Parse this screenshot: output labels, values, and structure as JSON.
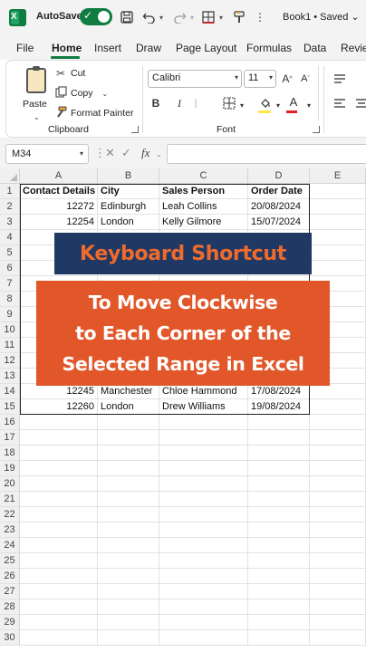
{
  "titlebar": {
    "autosave_label": "AutoSave",
    "autosave_on": true,
    "workbook_title": "Book1 • Saved ⌄"
  },
  "tabs": [
    "File",
    "Home",
    "Insert",
    "Draw",
    "Page Layout",
    "Formulas",
    "Data",
    "Review"
  ],
  "active_tab": "Home",
  "ribbon": {
    "clipboard": {
      "paste_label": "Paste",
      "cut_label": "Cut",
      "copy_label": "Copy",
      "format_painter_label": "Format Painter",
      "group_label": "Clipboard"
    },
    "font": {
      "font_name": "Calibri",
      "font_size": "11",
      "group_label": "Font"
    }
  },
  "formula_bar": {
    "name_box": "M34",
    "fx_label": "fx",
    "formula": ""
  },
  "grid": {
    "columns": [
      "A",
      "B",
      "C",
      "D",
      "E"
    ],
    "rows": [
      "1",
      "2",
      "3",
      "4",
      "5",
      "6",
      "7",
      "8",
      "9",
      "10",
      "11",
      "12",
      "13",
      "14",
      "15",
      "16",
      "17",
      "18",
      "19",
      "20",
      "21",
      "22",
      "23",
      "24",
      "25",
      "26",
      "27",
      "28",
      "29",
      "30"
    ],
    "header_row": [
      "Contact Details",
      "City",
      "Sales Person",
      "Order Date"
    ],
    "visible_rows": [
      {
        "row": 2,
        "id": "12272",
        "city": "Edinburgh",
        "person": "Leah Collins",
        "date": "20/08/2024"
      },
      {
        "row": 3,
        "id": "12254",
        "city": "London",
        "person": "Kelly Gilmore",
        "date": "15/07/2024"
      },
      {
        "row": 14,
        "id": "12245",
        "city": "Manchester",
        "person": "Chloe Hammond",
        "date": "17/08/2024"
      },
      {
        "row": 15,
        "id": "12260",
        "city": "London",
        "person": "Drew Williams",
        "date": "19/08/2024"
      }
    ]
  },
  "overlay": {
    "banner_title": "Keyboard Shortcut",
    "banner_lines": [
      "To Move Clockwise",
      "to Each Corner of the",
      "Selected Range in Excel"
    ]
  },
  "colors": {
    "excel_green": "#107c41",
    "banner_navy": "#203864",
    "banner_orange": "#e1572a",
    "banner_title_text": "#ee6b2c"
  }
}
